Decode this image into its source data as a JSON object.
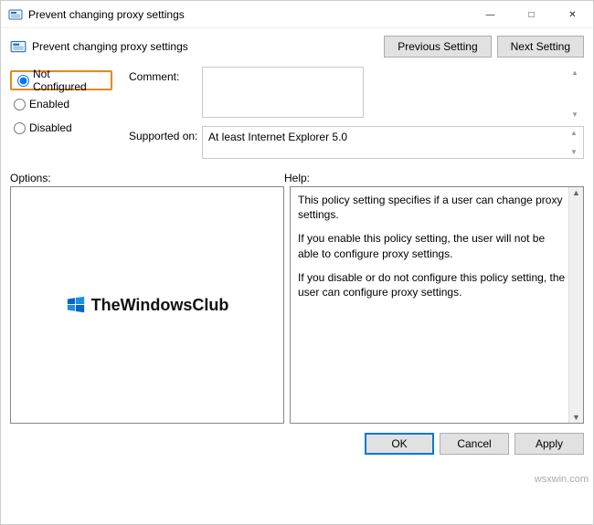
{
  "window": {
    "title": "Prevent changing proxy settings"
  },
  "header": {
    "title": "Prevent changing proxy settings",
    "prev": "Previous Setting",
    "next": "Next Setting"
  },
  "radios": {
    "not_configured": "Not Configured",
    "enabled": "Enabled",
    "disabled": "Disabled"
  },
  "fields": {
    "comment_label": "Comment:",
    "comment_value": "",
    "supported_label": "Supported on:",
    "supported_value": "At least Internet Explorer 5.0"
  },
  "sections": {
    "options": "Options:",
    "help": "Help:"
  },
  "help": {
    "p1": "This policy setting specifies if a user can change proxy settings.",
    "p2": "If you enable this policy setting, the user will not be able to configure proxy settings.",
    "p3": "If you disable or do not configure this policy setting, the user can configure proxy settings."
  },
  "options_content": {
    "brand": "TheWindowsClub"
  },
  "footer": {
    "ok": "OK",
    "cancel": "Cancel",
    "apply": "Apply"
  },
  "watermark": "wsxwin.com"
}
